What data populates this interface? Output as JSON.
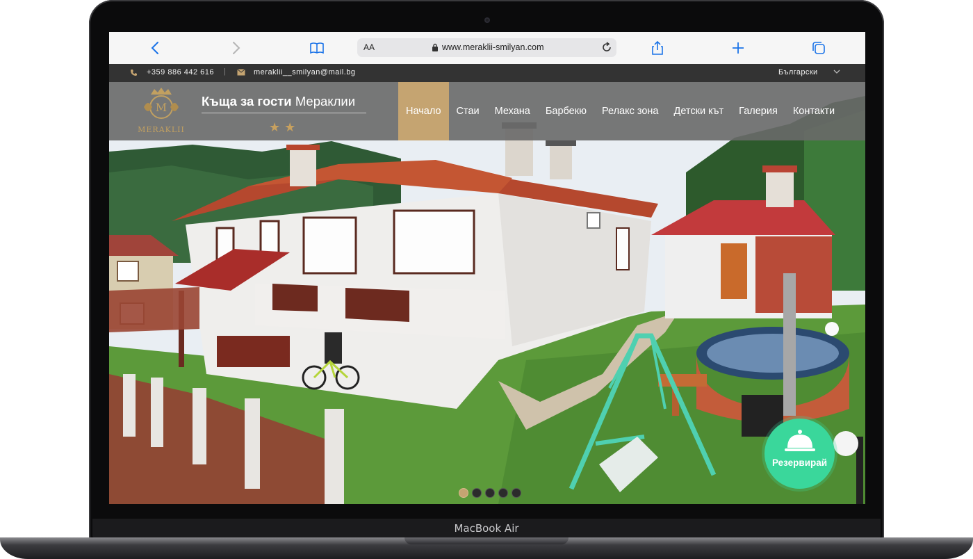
{
  "device": {
    "label": "MacBook Air"
  },
  "browser": {
    "text_size_label": "AA",
    "url": "www.meraklii-smilyan.com"
  },
  "topbar": {
    "phone": "+359 886 442 616",
    "separator": "|",
    "email": "meraklii__smilyan@mail.bg",
    "language": "Български"
  },
  "site": {
    "logo_text": "MERAKLII",
    "title_bold": "Къща за гости",
    "title_rest": "Мераклии",
    "stars": "★★"
  },
  "menu": [
    {
      "label": "Начало",
      "active": true
    },
    {
      "label": "Стаи",
      "active": false
    },
    {
      "label": "Механа",
      "active": false
    },
    {
      "label": "Барбекю",
      "active": false
    },
    {
      "label": "Релакс зона",
      "active": false
    },
    {
      "label": "Детски кът",
      "active": false
    },
    {
      "label": "Галерия",
      "active": false
    },
    {
      "label": "Контакти",
      "active": false
    }
  ],
  "slider": {
    "slides": 5,
    "active_index": 0
  },
  "book_button": {
    "label": "Резервирай",
    "icon": "bell-icon"
  },
  "colors": {
    "accent": "#c5a471",
    "book": "#3ad79b",
    "topbar": "#333333"
  }
}
